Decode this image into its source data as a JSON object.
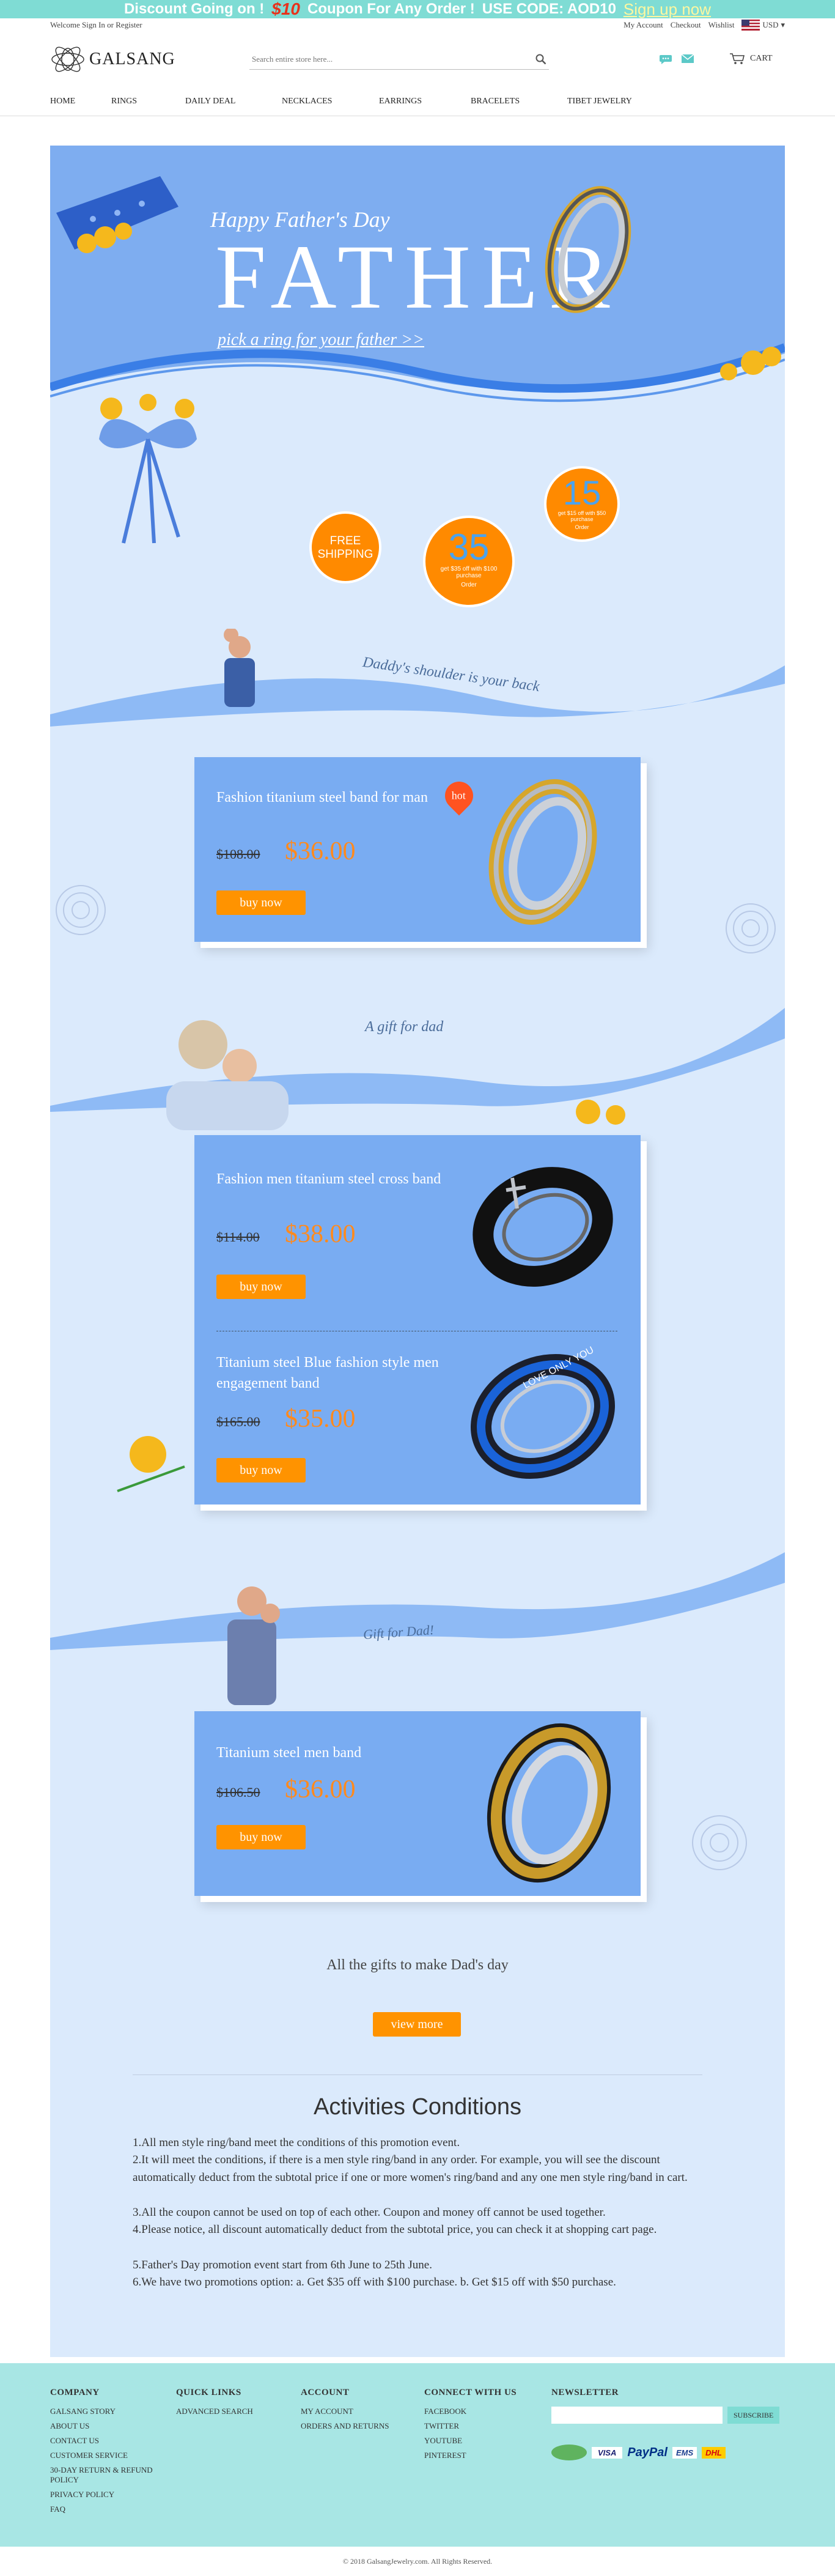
{
  "promo": {
    "text1": "Discount Going on !",
    "amount": "$10",
    "text2": "Coupon For Any Order !",
    "code": "USE CODE: AOD10",
    "signup": "Sign up now"
  },
  "topbar": {
    "welcome": "Welcome",
    "signin": "Sign In or Register",
    "account": "My Account",
    "checkout": "Checkout",
    "wishlist": "Wishlist",
    "currency": "USD"
  },
  "header": {
    "logo": "GALSANG",
    "search_placeholder": "Search entire store here...",
    "cart": "CART"
  },
  "nav": [
    "HOME",
    "RINGS",
    "DAILY DEAL",
    "NECKLACES",
    "EARRINGS",
    "BRACELETS",
    "TIBET JEWELRY"
  ],
  "hero": {
    "heading": "Happy Father's Day",
    "title": "FATHER",
    "link": "pick a ring for your father >>"
  },
  "tags": {
    "free1": "FREE",
    "free2": "SHIPPING",
    "t35": "35",
    "t35sub": "get $35 off with $100 purchase",
    "t35b": "Order",
    "t15": "15",
    "t15sub": "get $15 off with $50 purchase",
    "t15b": "Order"
  },
  "sections": [
    {
      "label": "Daddy's shoulder is your back"
    },
    {
      "label": "A gift for dad"
    },
    {
      "label": "Gift for Dad!"
    }
  ],
  "products": [
    {
      "title": "Fashion titanium steel band for man",
      "old": "$108.00",
      "new": "$36.00",
      "btn": "buy now",
      "badge": "hot"
    },
    {
      "title": "Fashion men titanium steel cross band",
      "old": "$114.00",
      "new": "$38.00",
      "btn": "buy now"
    },
    {
      "title": "Titanium steel Blue fashion style men engagement band",
      "old": "$165.00",
      "new": "$35.00",
      "btn": "buy now",
      "ring_text": "LOVE ONLY YOU"
    },
    {
      "title": "Titanium steel men band",
      "old": "$106.50",
      "new": "$36.00",
      "btn": "buy now"
    }
  ],
  "gifts": {
    "text": "All the gifts to make Dad's day",
    "btn": "view more"
  },
  "conditions": {
    "title": "Activities Conditions",
    "items": [
      "1.All men style ring/band meet the conditions of this promotion event.",
      "2.It will meet the conditions, if there is a men style ring/band in any order. For example, you will see the discount automatically deduct from the subtotal price if one or more women's ring/band and any one men style ring/band in cart.",
      "3.All the coupon cannot be used on top of each other. Coupon and money off cannot be used together.",
      "4.Please notice, all discount automatically deduct from the subtotal price, you can check it at shopping cart page.",
      "5.Father's Day promotion event start from 6th June to 25th June.",
      "6.We have two promotions option:    a. Get $35 off with $100 purchase.     b. Get $15 off with $50 purchase."
    ]
  },
  "footer": {
    "company": {
      "title": "COMPANY",
      "items": [
        "GALSANG STORY",
        "ABOUT US",
        "CONTACT US",
        "CUSTOMER SERVICE",
        "30-DAY RETURN & REFUND POLICY",
        "PRIVACY POLICY",
        "FAQ"
      ]
    },
    "quick": {
      "title": "QUICK LINKS",
      "items": [
        "ADVANCED SEARCH"
      ]
    },
    "account": {
      "title": "ACCOUNT",
      "items": [
        "MY ACCOUNT",
        "ORDERS AND RETURNS"
      ]
    },
    "connect": {
      "title": "CONNECT WITH US",
      "items": [
        "FACEBOOK",
        "TWITTER",
        "YOUTUBE",
        "PINTEREST"
      ]
    },
    "newsletter": {
      "title": "NEWSLETTER",
      "btn": "SUBSCRIBE"
    },
    "payments": [
      "VISA",
      "PayPal",
      "EMS",
      "DHL"
    ],
    "copyright": "© 2018 GalsangJewelry.com. All Rights Reserved."
  },
  "colors": {
    "teal": "#7fdcd4",
    "blue": "#79acf2",
    "orange": "#ff9300",
    "footer": "#a8e6e4"
  }
}
